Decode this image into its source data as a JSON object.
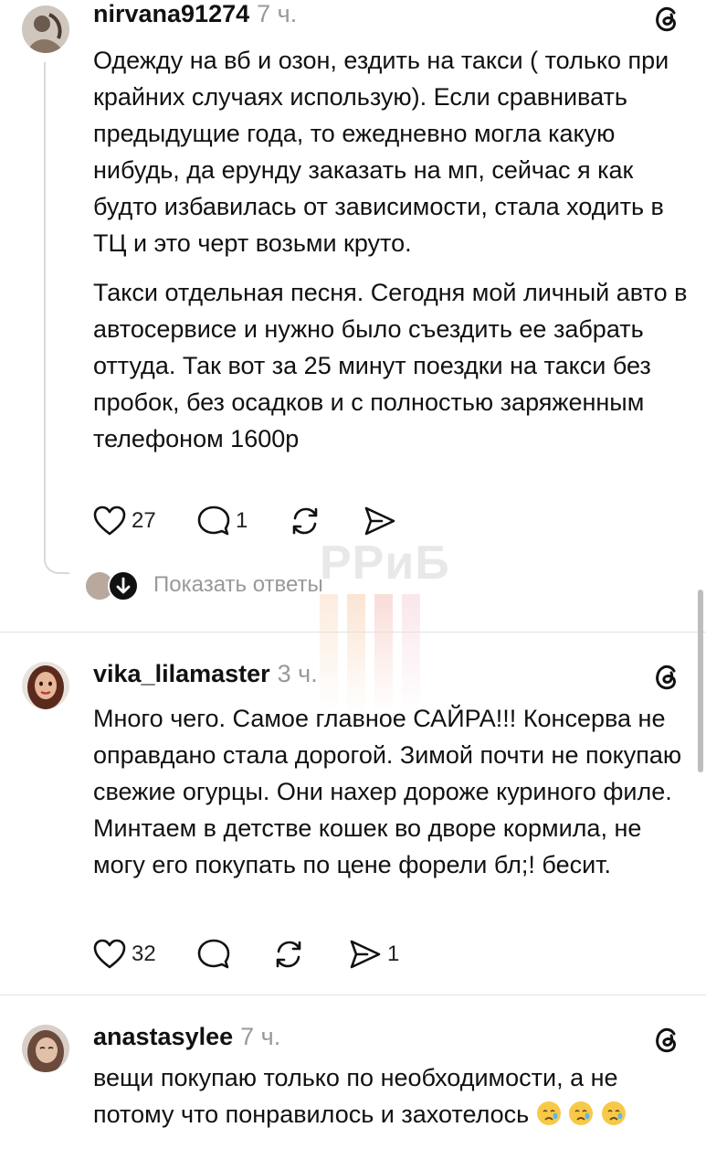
{
  "watermark": "РРиБ",
  "show_replies_label": "Показать ответы",
  "posts": [
    {
      "username": "nirvana91274",
      "time": "7 ч.",
      "paragraphs": [
        "Одежду на вб и озон, ездить на такси ( только при крайних случаях использую). Если сравнивать предыдущие года, то ежедневно могла какую нибудь, да ерунду заказать на мп, сейчас я как будто избавилась от зависимости, стала ходить в ТЦ и это черт возьми круто.",
        "Такси отдельная песня. Сегодня мой личный авто в автосервисе и нужно было съездить ее забрать оттуда. Так вот за 25 минут поездки на такси без пробок, без осадков и с полностью заряженным телефоном 1600р"
      ],
      "likes": "27",
      "comments": "1",
      "reposts": "",
      "shares": ""
    },
    {
      "username": "vika_lilamaster",
      "time": "3 ч.",
      "paragraphs": [
        "Много чего. Самое главное САЙРА!!! Консерва не оправдано стала дорогой. Зимой почти не покупаю свежие огурцы. Они нахер дороже куриного филе. Минтаем в детстве кошек во дворе кормила, не могу его покупать по цене форели бл;! бесит."
      ],
      "likes": "32",
      "comments": "",
      "reposts": "",
      "shares": "1"
    },
    {
      "username": "anastasylee",
      "time": "7 ч.",
      "paragraphs": [
        "вещи покупаю только по необходимости, а не потому что понравилось и захотелось"
      ],
      "emoji": "crying-face-emoji"
    }
  ],
  "colors": {
    "text": "#111111",
    "muted": "#999999",
    "divider": "#e3e3e3"
  }
}
